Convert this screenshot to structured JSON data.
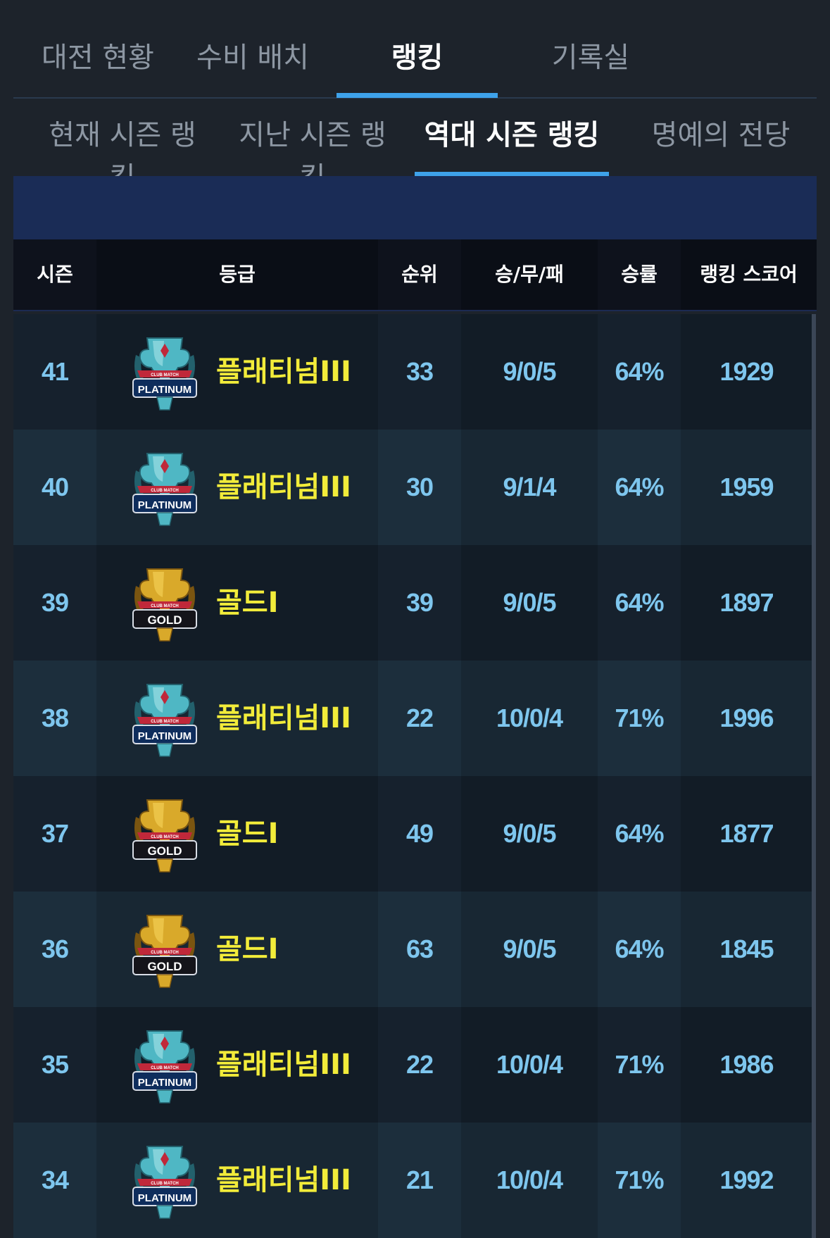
{
  "top_tabs": [
    "대전 현황",
    "수비 배치",
    "랭킹",
    "기록실"
  ],
  "top_active_index": 2,
  "sub_tabs": [
    "현재 시즌 랭킹",
    "지난 시즌 랭킹",
    "역대 시즌 랭킹",
    "명예의 전당"
  ],
  "sub_active_index": 2,
  "columns": {
    "season": "시즌",
    "grade": "등급",
    "rank": "순위",
    "record": "승/무/패",
    "winrate": "승률",
    "score": "랭킹 스코어"
  },
  "badge_text": {
    "platinum": "PLATINUM",
    "gold": "GOLD",
    "club_match": "CLUB MATCH"
  },
  "rows": [
    {
      "season": "41",
      "tier": "platinum",
      "grade": "플래티넘III",
      "rank": "33",
      "record": "9/0/5",
      "winrate": "64%",
      "score": "1929"
    },
    {
      "season": "40",
      "tier": "platinum",
      "grade": "플래티넘III",
      "rank": "30",
      "record": "9/1/4",
      "winrate": "64%",
      "score": "1959"
    },
    {
      "season": "39",
      "tier": "gold",
      "grade": "골드I",
      "rank": "39",
      "record": "9/0/5",
      "winrate": "64%",
      "score": "1897"
    },
    {
      "season": "38",
      "tier": "platinum",
      "grade": "플래티넘III",
      "rank": "22",
      "record": "10/0/4",
      "winrate": "71%",
      "score": "1996"
    },
    {
      "season": "37",
      "tier": "gold",
      "grade": "골드I",
      "rank": "49",
      "record": "9/0/5",
      "winrate": "64%",
      "score": "1877"
    },
    {
      "season": "36",
      "tier": "gold",
      "grade": "골드I",
      "rank": "63",
      "record": "9/0/5",
      "winrate": "64%",
      "score": "1845"
    },
    {
      "season": "35",
      "tier": "platinum",
      "grade": "플래티넘III",
      "rank": "22",
      "record": "10/0/4",
      "winrate": "71%",
      "score": "1986"
    },
    {
      "season": "34",
      "tier": "platinum",
      "grade": "플래티넘III",
      "rank": "21",
      "record": "10/0/4",
      "winrate": "71%",
      "score": "1992"
    }
  ],
  "colors": {
    "accent": "#3ea2ea",
    "grade_text": "#f2ec3a",
    "value_text": "#7ec6ee",
    "banner": "#1a2c56"
  }
}
